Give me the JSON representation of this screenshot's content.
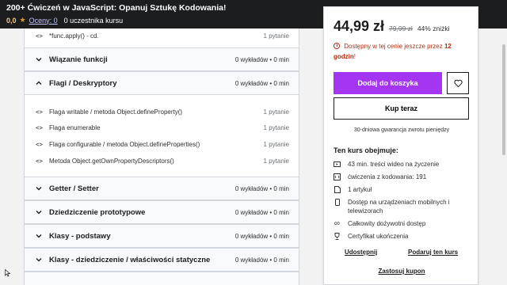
{
  "header": {
    "title": "200+ Ćwiczeń w JavaScript: Opanuj Sztukę Kodowania!",
    "rating": "0,0",
    "ratings_link": "Oceny: 0",
    "students": "0 uczestnika kursu"
  },
  "curriculum": {
    "top_lesson": {
      "name": "*func.apply() - cd.",
      "meta": "1 pytanie",
      "icon": "code-icon"
    },
    "sections": [
      {
        "name": "Wiązanie funkcji",
        "meta": "0 wykładów • 0 min",
        "expanded": false
      },
      {
        "name": "Flagi / Deskryptory",
        "meta": "0 wykładów • 0 min",
        "expanded": true,
        "lessons": [
          {
            "name": "Flaga writable / metoda Object.defineProperty()",
            "meta": "1 pytanie",
            "icon": "code-icon"
          },
          {
            "name": "Flaga enumerable",
            "meta": "1 pytanie",
            "icon": "code-icon"
          },
          {
            "name": "Flaga configurable / metoda Object.defineProperties()",
            "meta": "1 pytanie",
            "icon": "code-icon"
          },
          {
            "name": "Metoda Object.getOwnPropertyDescriptors()",
            "meta": "1 pytanie",
            "icon": "code-icon"
          }
        ]
      },
      {
        "name": "Getter / Setter",
        "meta": "0 wykładów • 0 min",
        "expanded": false
      },
      {
        "name": "Dziedziczenie prototypowe",
        "meta": "0 wykładów • 0 min",
        "expanded": false
      },
      {
        "name": "Klasy - podstawy",
        "meta": "0 wykładów • 0 min",
        "expanded": false
      },
      {
        "name": "Klasy - dziedziczenie / właściwości statyczne",
        "meta": "0 wykładów • 0 min",
        "expanded": false
      }
    ]
  },
  "purchase": {
    "price": "44,99 zł",
    "old_price": "79,99 zł",
    "discount": "44% zniżki",
    "timer_prefix": "Dostępny w tej cenie jeszcze przez",
    "timer_amount": "12 godzin",
    "timer_suffix": "!",
    "add_to_cart": "Dodaj do koszyka",
    "buy_now": "Kup teraz",
    "guarantee": "30-dniowa gwarancja zwrotu pieniędzy",
    "includes_title": "Ten kurs obejmuje:",
    "includes": [
      {
        "icon": "video-icon",
        "text": "43 min. treści wideo na życzenie"
      },
      {
        "icon": "code-icon",
        "text": "ćwiczenia z kodowania: 191"
      },
      {
        "icon": "file-icon",
        "text": "1 artykuł"
      },
      {
        "icon": "mobile-icon",
        "text": "Dostęp na urządzeniach mobilnych i telewizorach"
      },
      {
        "icon": "infinity-icon",
        "text": "Całkowity dożywotni dostęp"
      },
      {
        "icon": "trophy-icon",
        "text": "Certyfikat ukończenia"
      }
    ],
    "share": "Udostępnij",
    "gift": "Podaruj ten kurs",
    "coupon": "Zastosuj kupon"
  },
  "colors": {
    "accent": "#a435f0",
    "topbar": "#1c1d1f",
    "alert": "#b32d0f",
    "star": "#e59819"
  }
}
